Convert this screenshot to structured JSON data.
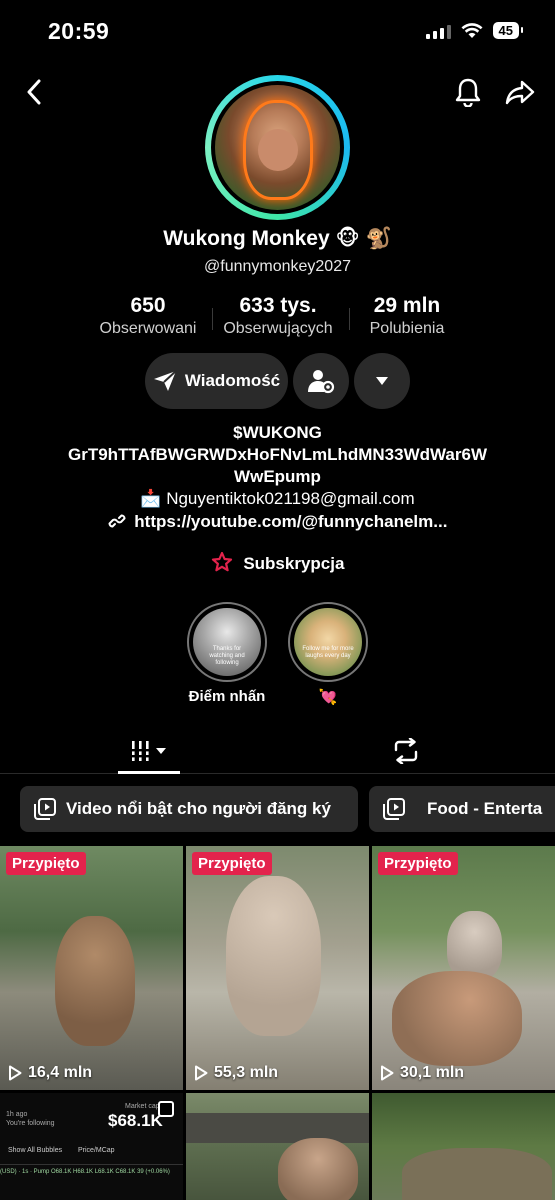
{
  "status_bar": {
    "time": "20:59",
    "battery": "45"
  },
  "profile": {
    "name": "Wukong Monkey 🐵 🐒",
    "handle": "@funnymonkey2027"
  },
  "stats": [
    {
      "value": "650",
      "label": "Obserwowani"
    },
    {
      "value": "633 tys.",
      "label": "Obserwujących"
    },
    {
      "value": "29 mln",
      "label": "Polubienia"
    }
  ],
  "actions": {
    "message_label": "Wiadomość"
  },
  "bio": {
    "line1": "$WUKONG",
    "line2": "GrT9hTTAfBWGRWDxHoFNvLmLhdMN33WdWar6W",
    "line3": "WwEpump",
    "email": "📩 Nguyentiktok021198@gmail.com",
    "link": "https://youtube.com/@funnychanelm..."
  },
  "subscription_label": "Subskrypcja",
  "highlights": [
    {
      "caption": "Thanks for watching and following",
      "label": "Điểm nhấn"
    },
    {
      "caption": "Follow me for more laughs every day",
      "label": "💘"
    }
  ],
  "playlists": [
    {
      "label": "Video nổi bật cho người đăng ký"
    },
    {
      "label": "Food - Enterta"
    }
  ],
  "videos": [
    {
      "badge": "Przypięto",
      "views": "16,4 mln"
    },
    {
      "badge": "Przypięto",
      "views": "55,3 mln"
    },
    {
      "badge": "Przypięto",
      "views": "30,1 mln"
    }
  ],
  "crypto_tile": {
    "ago": "1h ago",
    "following": "You're following",
    "market_cap_label": "Market cap",
    "market_cap": "$68.1K",
    "bubbles": "Show All Bubbles",
    "price_mcap": "Price/MCap",
    "ticker": "(USD) · 1s · Pump  O68.1K H68.1K L68.1K C68.1K 39 (+0.06%)"
  },
  "colors": {
    "pinned": "#e3234c",
    "ring_start": "#28d7e9",
    "ring_end": "#3ee6a8",
    "button_bg": "#2a2a2a"
  }
}
